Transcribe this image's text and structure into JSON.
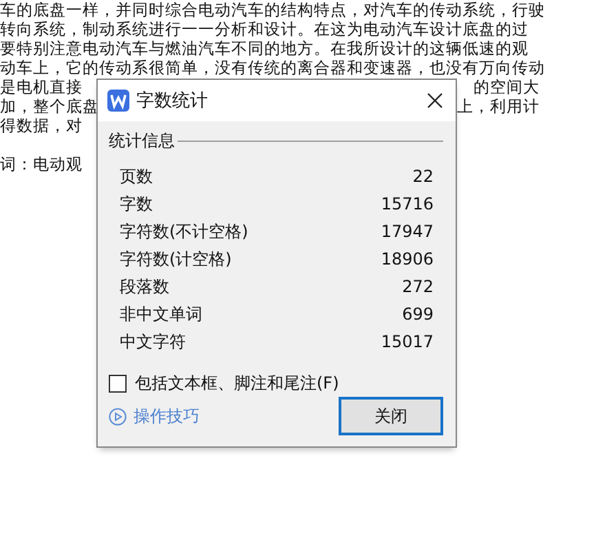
{
  "document": {
    "lines": [
      {
        "text": "车的底盘一样，并同时综合电动汽车的结构特点，对汽车的传动系统，行驶"
      },
      {
        "text": "转向系统，制动系统进行一一分析和设计。在这为电动汽车设计底盘的过"
      },
      {
        "text": "要特别注意电动汽车与燃油汽车不同的地方。在我所设计的这辆低速的观"
      },
      {
        "text": "动车上，它的传动系很简单，没有传统的离合器和变速器，也没有万向传动"
      },
      {
        "text": "是电机直接",
        "tail": "的空间大"
      },
      {
        "text": "加，整个底盘",
        "tail": "上，利用计"
      },
      {
        "text": "得数据，对"
      },
      {
        "text": "词：电动观"
      }
    ]
  },
  "dialog": {
    "title": "字数统计",
    "section": "统计信息",
    "stats": [
      {
        "label": "页数",
        "value": "22"
      },
      {
        "label": "字数",
        "value": "15716"
      },
      {
        "label": "字符数(不计空格)",
        "value": "17947"
      },
      {
        "label": "字符数(计空格)",
        "value": "18906"
      },
      {
        "label": "段落数",
        "value": "272"
      },
      {
        "label": "非中文单词",
        "value": "699"
      },
      {
        "label": "中文字符",
        "value": "15017"
      }
    ],
    "checkbox": {
      "label": "包括文本框、脚注和尾注(F)",
      "checked": false
    },
    "tips_link": "操作技巧",
    "close_button": "关闭"
  }
}
